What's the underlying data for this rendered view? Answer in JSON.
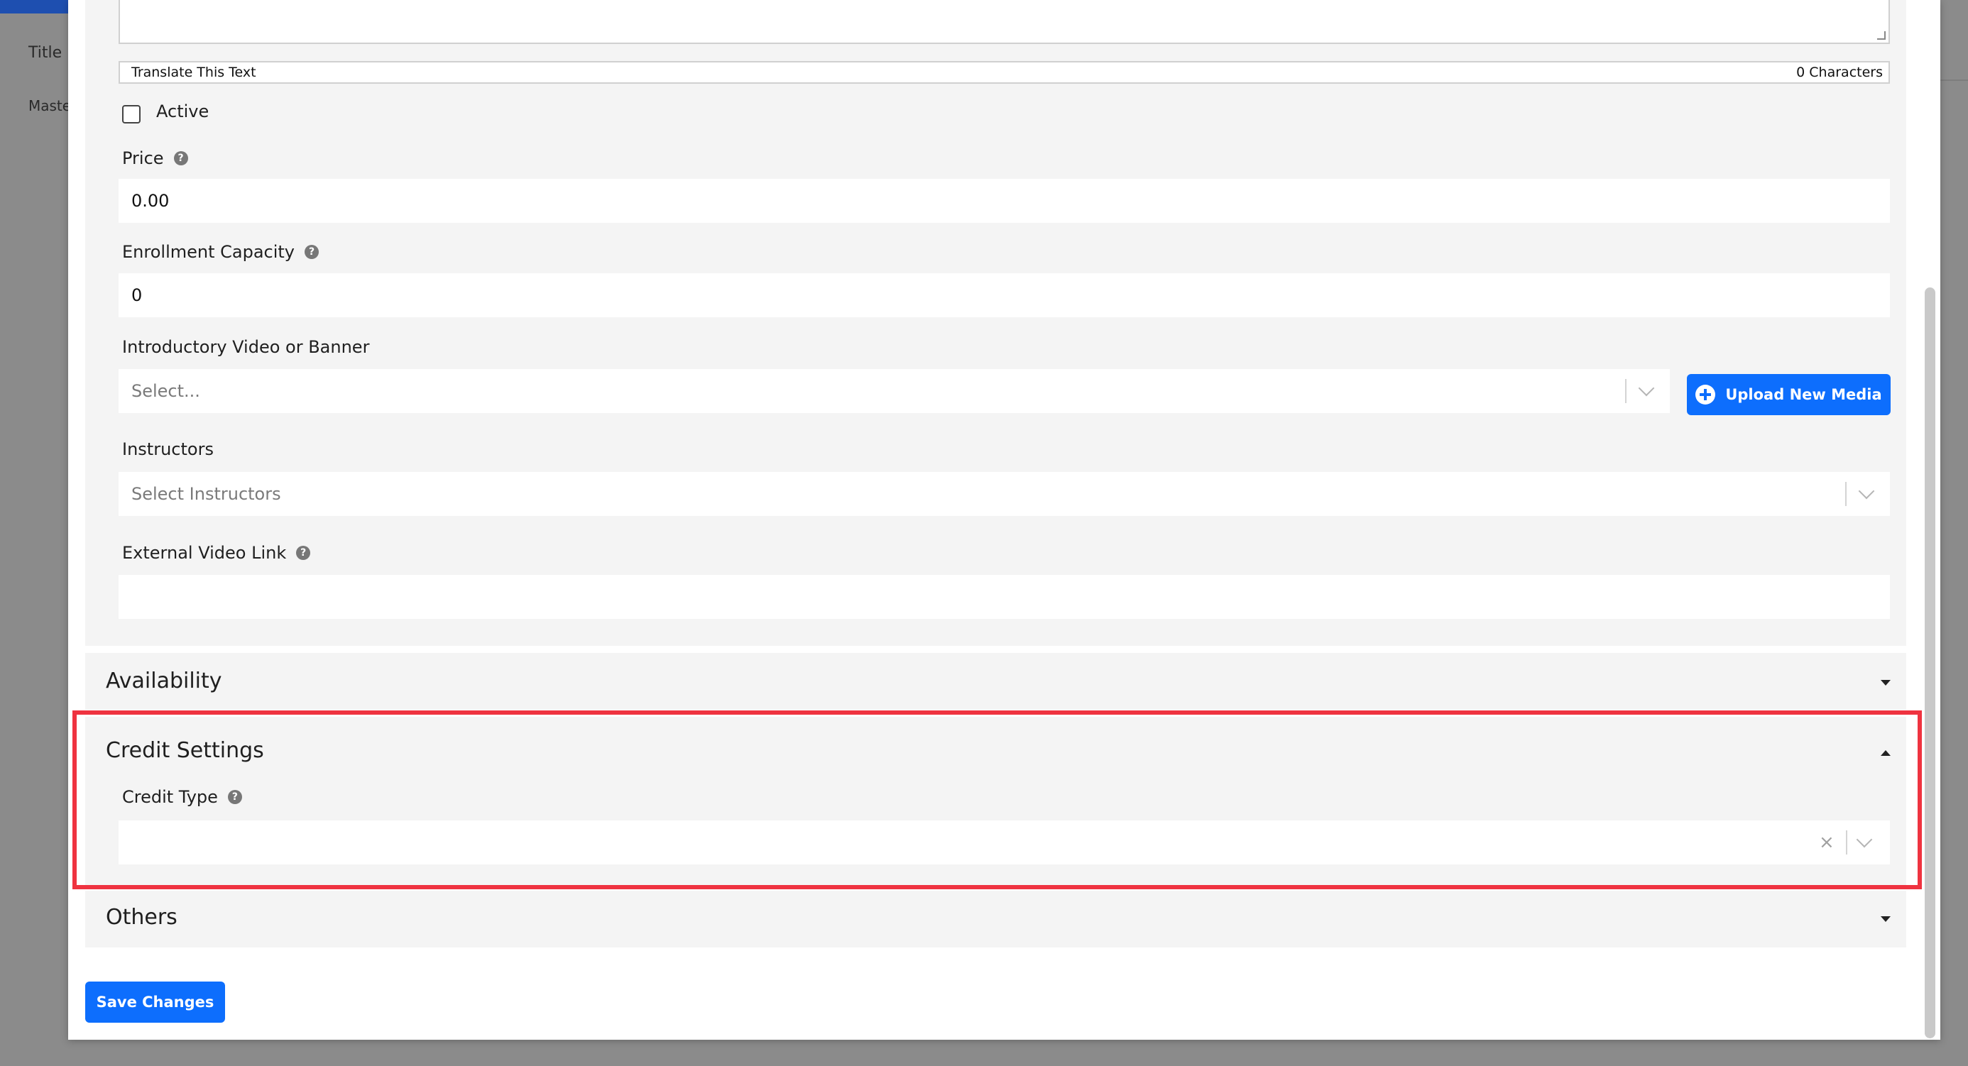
{
  "background": {
    "column_title": "Title",
    "row_text": "Maste"
  },
  "description": {
    "translate_label": "Translate This Text",
    "char_count": "0 Characters"
  },
  "active": {
    "label": "Active",
    "checked": false
  },
  "price": {
    "label": "Price",
    "value": "0.00"
  },
  "enrollment": {
    "label": "Enrollment Capacity",
    "value": "0"
  },
  "intro_media": {
    "label": "Introductory Video or Banner",
    "placeholder": "Select...",
    "upload_label": "Upload New Media"
  },
  "instructors": {
    "label": "Instructors",
    "placeholder": "Select Instructors"
  },
  "external_video": {
    "label": "External Video Link",
    "value": ""
  },
  "sections": {
    "availability": {
      "title": "Availability",
      "expanded": false
    },
    "credit_settings": {
      "title": "Credit Settings",
      "expanded": true,
      "credit_type_label": "Credit Type",
      "credit_type_value": "",
      "clear_glyph": "×"
    },
    "others": {
      "title": "Others",
      "expanded": false
    }
  },
  "save_label": "Save Changes",
  "help_glyph": "?",
  "colors": {
    "primary": "#0d6efd",
    "highlight": "#ef3340",
    "panel": "#f4f4f4"
  }
}
